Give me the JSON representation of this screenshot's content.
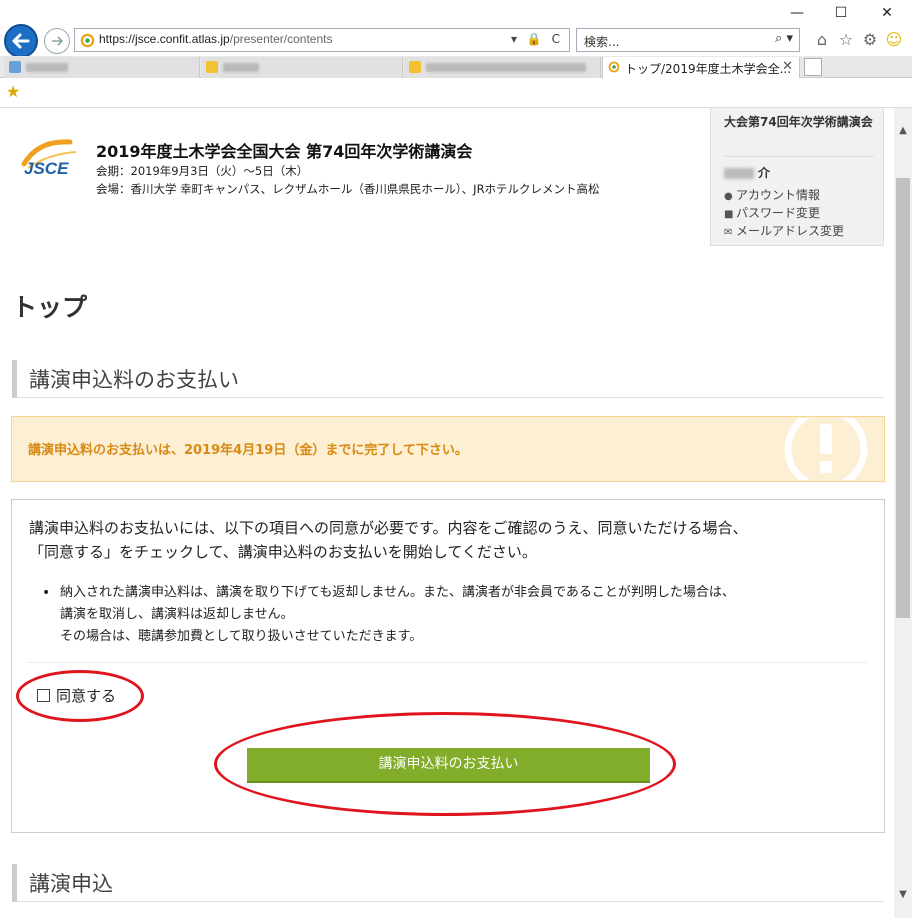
{
  "window": {
    "minimize": "—",
    "maximize": "☐",
    "close": "✕"
  },
  "browser": {
    "url_main": "https://jsce.confit.atlas.jp",
    "url_path": "/presenter/contents",
    "address_tools": "▾ 🔒 C",
    "search_placeholder": "検索...",
    "search_tools": "⌕ ▾",
    "tabs": [
      {
        "label": "",
        "blurred": true
      },
      {
        "label": "",
        "blurred": true
      },
      {
        "label": "",
        "blurred": true
      },
      {
        "label": "トップ/2019年度土木学会全...",
        "close": "✕",
        "active": true
      }
    ]
  },
  "header": {
    "logo_text": "JSCE",
    "title": "2019年度土木学会全国大会 第74回年次学術講演会",
    "period": "会期：2019年9月3日（火）～5日（木）",
    "venue": "会場：香川大学 幸町キャンパス、レクザムホール（香川県県民ホール）、JRホテルクレメント高松"
  },
  "user_panel": {
    "conference": "大会第74回年次学術講演会",
    "user_name_suffix": "介",
    "links": [
      {
        "icon": "user-icon",
        "glyph": "👤",
        "label": "アカウント情報"
      },
      {
        "icon": "lock-icon",
        "glyph": "🔒",
        "label": "パスワード変更"
      },
      {
        "icon": "envelope-icon",
        "glyph": "✉",
        "label": "メールアドレス変更"
      }
    ]
  },
  "main": {
    "page_title": "トップ",
    "section_payment": "講演申込料のお支払い",
    "alert": "講演申込料のお支払いは、2019年4月19日（金）までに完了して下さい。",
    "intro_line1": "講演申込料のお支払いには、以下の項目への同意が必要です。内容をご確認のうえ、同意いただける場合、",
    "intro_line2": "「同意する」をチェックして、講演申込料のお支払いを開始してください。",
    "terms": [
      "納入された講演申込料は、講演を取り下げても返却しません。また、講演者が非会員であることが判明した場合は、",
      "講演を取消し、講演料は返却しません。",
      "その場合は、聴講参加費として取り扱いさせていただきます。"
    ],
    "agree_label": "同意する",
    "agree_checked": false,
    "pay_button": "講演申込料のお支払い",
    "section_application": "講演申込"
  },
  "colors": {
    "accent_green": "#82ad2a",
    "alert_bg": "#fcefd4",
    "alert_text": "#d88a12",
    "annotation_red": "#e0141e",
    "browser_blue": "#1c6fc4"
  }
}
